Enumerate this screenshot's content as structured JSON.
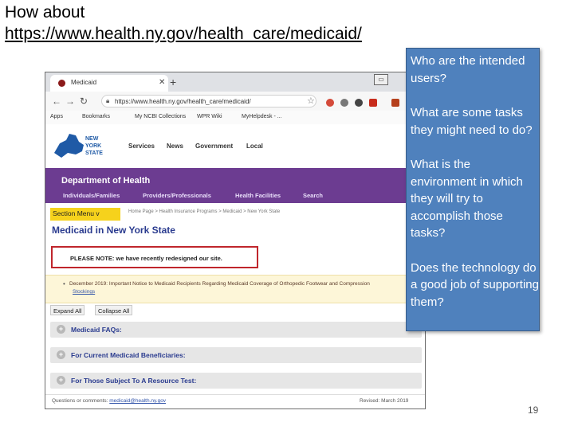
{
  "slide": {
    "title_prefix": "How about",
    "title_link": "https://www.health.ny.gov/health_care/medicaid/",
    "page_number": "19"
  },
  "questions": [
    "Who are the intended users?",
    "What are some tasks they might need to do?",
    "What is the environment in which they will try to accomplish those tasks?",
    "Does the technology do a good job of supporting them?"
  ],
  "browser": {
    "tab_title": "Medicaid",
    "url": "https://www.health.ny.gov/health_care/medicaid/",
    "bookmarks": [
      "Apps",
      "Bookmarks",
      "My NCBI Collections",
      "WPR Wiki",
      "MyHelpdesk - ..."
    ]
  },
  "site": {
    "state_logo_text": "NEW YORK STATE",
    "nav": [
      "Services",
      "News",
      "Government",
      "Local"
    ],
    "department": "Department of Health",
    "audience_links": [
      "Individuals/Families",
      "Providers/Professionals",
      "Health Facilities",
      "Search"
    ],
    "section_menu": "Section Menu",
    "breadcrumb": "Home Page > Health Insurance Programs > Medicaid > New York State",
    "page_title": "Medicaid in New York State",
    "notice": "PLEASE NOTE: we have recently redesigned our site.",
    "alert_text": "December 2019: Important Notice to Medicaid Recipients Regarding Medicaid Coverage of Orthopedic Footwear and Compression",
    "alert_link": "Stockings",
    "expand_all": "Expand All",
    "collapse_all": "Collapse All",
    "accordion": [
      "Medicaid FAQs:",
      "For Current Medicaid Beneficiaries:",
      "For Those Subject To A Resource Test:"
    ],
    "footer_questions": "Questions or comments:",
    "footer_email": "medicaid@health.ny.gov",
    "footer_revised": "Revised: March 2019"
  },
  "colors": {
    "question_panel": "#4f81bd",
    "doh_band": "#6c3c91",
    "section_menu": "#f6d21c",
    "notice_border": "#c0262c"
  }
}
